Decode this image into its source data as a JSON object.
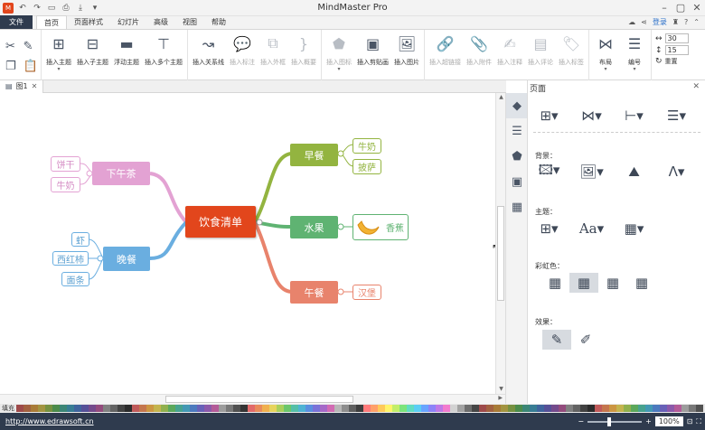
{
  "app": {
    "title": "MindMaster Pro",
    "quick_access": [
      "logo-icon",
      "undo-icon",
      "redo-icon",
      "save-icon",
      "print-icon",
      "export-icon",
      "dropdown-icon"
    ]
  },
  "menu": {
    "file": "文件",
    "tabs": [
      "首页",
      "页面样式",
      "幻灯片",
      "高级",
      "视图",
      "帮助"
    ],
    "active_tab": "首页",
    "right": {
      "login": "登录"
    }
  },
  "ribbon": {
    "insert_topic": "插入主题",
    "insert_subtopic": "插入子主题",
    "floating_topic": "浮动主题",
    "multi_topic": "插入多个主题",
    "relationship": "插入关系线",
    "callout": "插入标注",
    "boundary": "插入外框",
    "summary": "插入概要",
    "icon": "插入图标",
    "clipart": "插入剪贴画",
    "picture": "插入图片",
    "hyperlink": "插入超链接",
    "attachment": "插入附件",
    "note": "插入注释",
    "comment": "插入评论",
    "tag": "插入标签",
    "layout": "布局",
    "number": "编号",
    "spacing_h": "30",
    "spacing_v": "15",
    "reset": "重置"
  },
  "doc_tab": {
    "label": "图1"
  },
  "mindmap": {
    "center": "饮食清单",
    "branches": [
      {
        "label": "早餐",
        "color": "#93b440",
        "leaves": [
          "牛奶",
          "披萨"
        ]
      },
      {
        "label": "水果",
        "color": "#5fb372",
        "leaves": [
          "香蕉"
        ]
      },
      {
        "label": "午餐",
        "color": "#e8836c",
        "leaves": [
          "汉堡"
        ]
      },
      {
        "label": "下午茶",
        "color": "#e3a2d3",
        "leaves": [
          "饼干",
          "牛奶"
        ]
      },
      {
        "label": "晚餐",
        "color": "#6aaee0",
        "leaves": [
          "虾",
          "西红柿",
          "面条"
        ]
      }
    ],
    "center_color": "#e2461c"
  },
  "panel": {
    "title": "页面",
    "sections": {
      "background": "背景：",
      "theme": "主题：",
      "rainbow": "彩虹色：",
      "effect": "效果："
    }
  },
  "colorbar": {
    "label": "填充"
  },
  "status": {
    "url": "http://www.edrawsoft.cn",
    "zoom": "100%"
  }
}
